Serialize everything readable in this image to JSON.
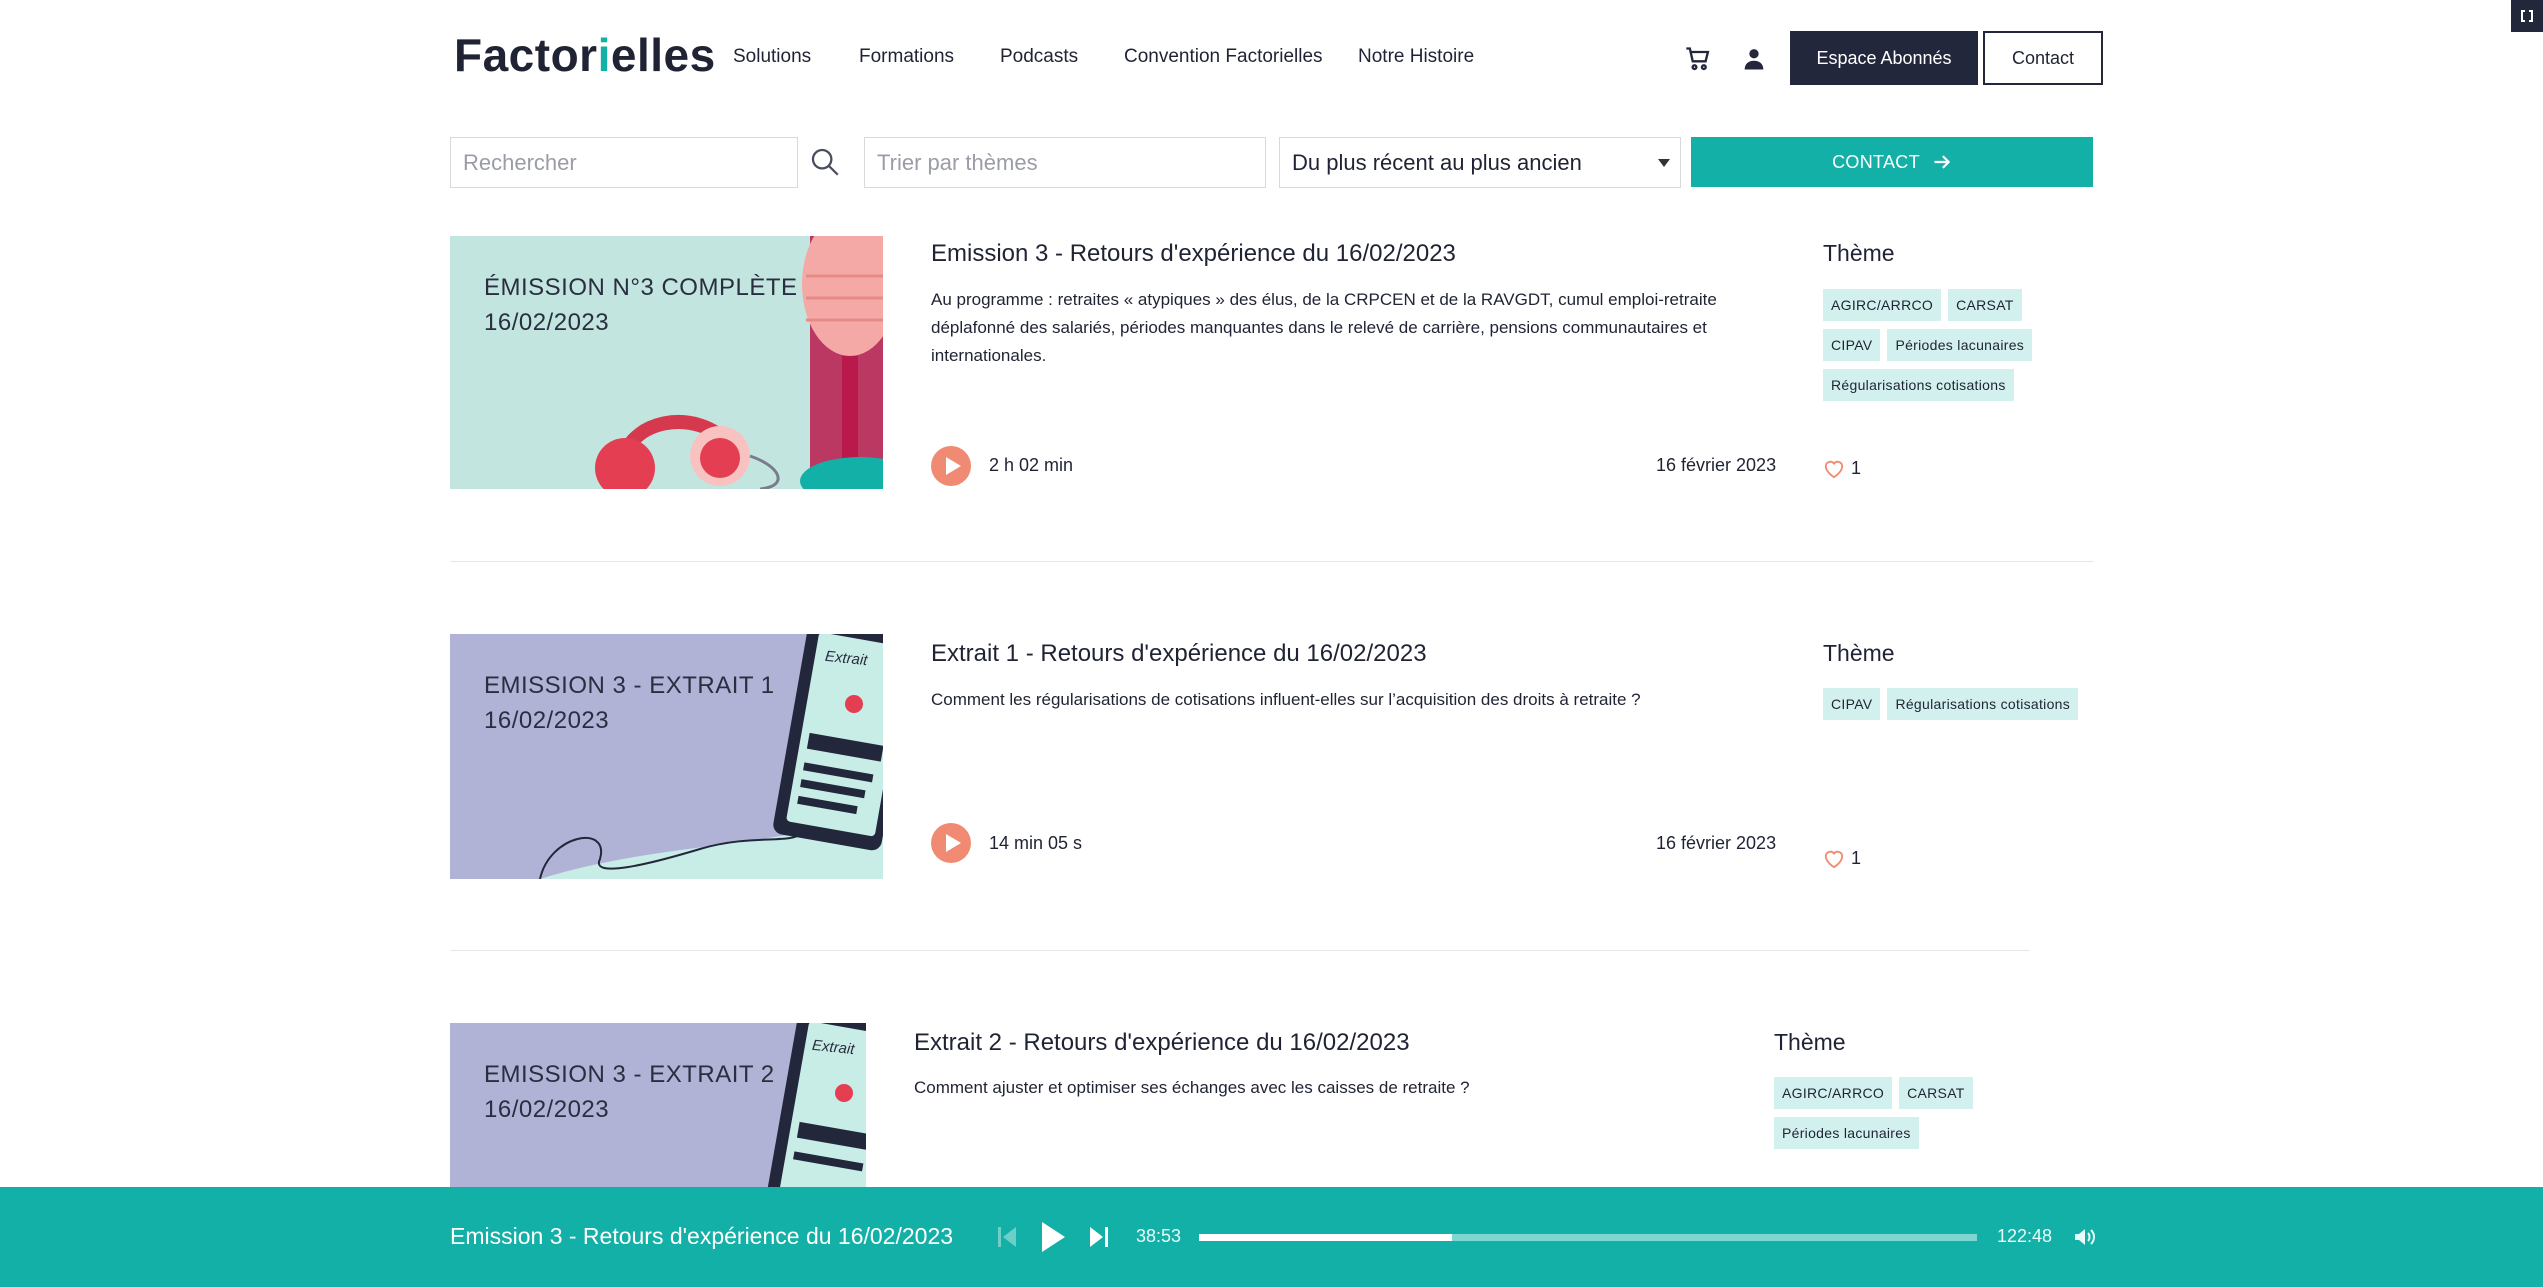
{
  "header": {
    "logo_pre": "Factor",
    "logo_accent": "i",
    "logo_post": "elles",
    "nav": [
      "Solutions",
      "Formations",
      "Podcasts",
      "Convention Factorielles",
      "Notre Histoire"
    ],
    "subscribers_button": "Espace Abonnés",
    "contact_button": "Contact",
    "icons": [
      "cart-icon",
      "user-icon"
    ]
  },
  "filters": {
    "search_placeholder": "Rechercher",
    "themes_placeholder": "Trier par thèmes",
    "sort_value": "Du plus récent au plus ancien",
    "cta_label": "CONTACT"
  },
  "episodes": [
    {
      "thumb_line1": "ÉMISSION N°3 COMPLÈTE",
      "thumb_line2": "16/02/2023",
      "title": "Emission 3 - Retours d'expérience du 16/02/2023",
      "description": "Au programme : retraites « atypiques » des élus, de la CRPCEN et de la RAVGDT, cumul emploi-retraite déplafonné des salariés, périodes manquantes dans le relevé de carrière, pensions communautaires et internationales.",
      "duration": "2 h 02 min",
      "date": "16 février 2023",
      "theme_label": "Thème",
      "tags": [
        "AGIRC/ARRCO",
        "CARSAT",
        "CIPAV",
        "Périodes lacunaires",
        "Régularisations cotisations"
      ],
      "likes": "1"
    },
    {
      "thumb_line1": "EMISSION 3 - EXTRAIT 1",
      "thumb_line2": "16/02/2023",
      "thumb_badge": "Extrait",
      "title": "Extrait 1 - Retours d'expérience du 16/02/2023",
      "description": "Comment les régularisations de cotisations influent-elles sur l’acquisition des droits à retraite ?",
      "duration": "14 min 05 s",
      "date": "16 février 2023",
      "theme_label": "Thème",
      "tags": [
        "CIPAV",
        "Régularisations cotisations"
      ],
      "likes": "1"
    },
    {
      "thumb_line1": "EMISSION 3 - EXTRAIT 2",
      "thumb_line2": "16/02/2023",
      "thumb_badge": "Extrait",
      "title": "Extrait 2 - Retours d'expérience du 16/02/2023",
      "description": "Comment ajuster et optimiser ses échanges avec les caisses de retraite ?",
      "theme_label": "Thème",
      "tags": [
        "AGIRC/ARRCO",
        "CARSAT",
        "Périodes lacunaires"
      ]
    }
  ],
  "player": {
    "title": "Emission 3 - Retours d'expérience du 16/02/2023",
    "elapsed": "38:53",
    "total": "122:48",
    "progress": 0.325
  },
  "colors": {
    "accent": "#12b0a6",
    "navy": "#23273b",
    "tag_bg": "#d2f0ee",
    "play": "#f08a73",
    "thumb_teal": "#c2e6df",
    "thumb_lavender": "#b1b3d6"
  }
}
